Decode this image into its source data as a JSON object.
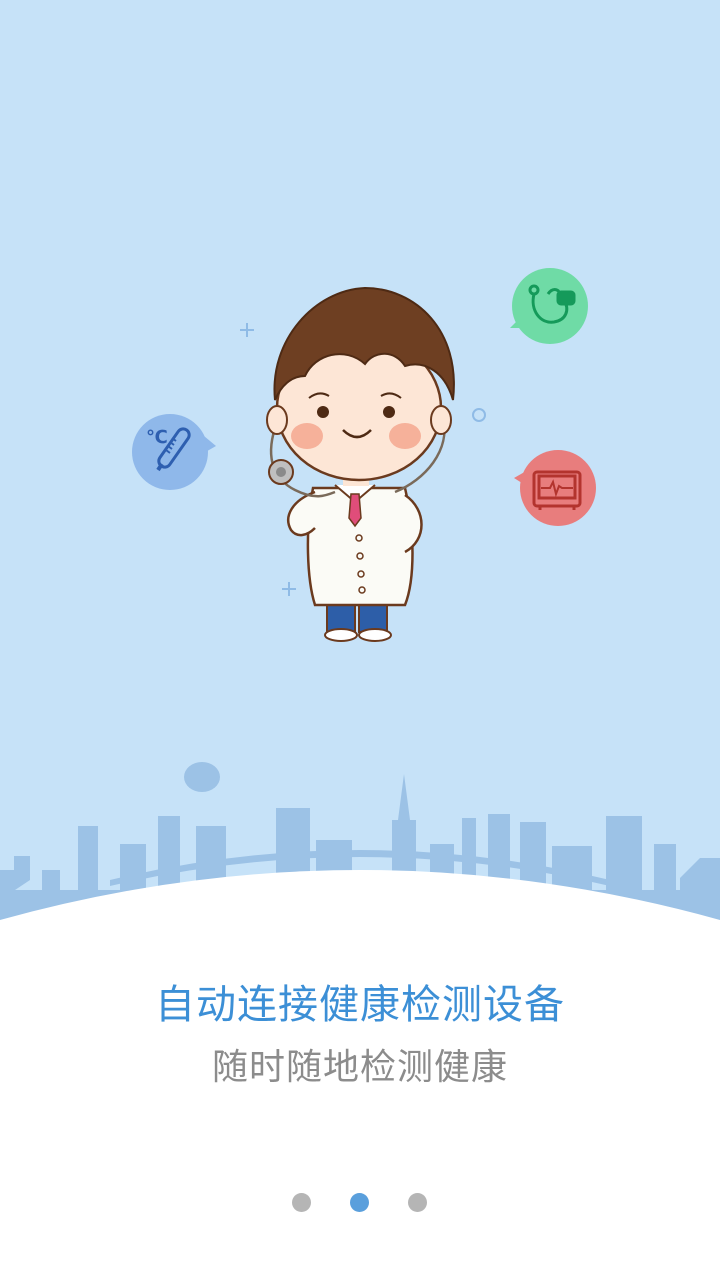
{
  "onboarding": {
    "title": "自动连接健康检测设备",
    "subtitle": "随时随地检测健康",
    "page_indicator": {
      "total": 3,
      "current": 2
    }
  },
  "icons": {
    "thermometer": "thermometer-icon",
    "stethoscope": "stethoscope-icon",
    "monitor": "heart-monitor-icon",
    "thermometer_unit": "℃"
  },
  "colors": {
    "background": "#c6e2f8",
    "title": "#3c8fd6",
    "subtitle": "#8c8c8c",
    "dot_active": "#5a9fdc",
    "dot_inactive": "#b5b5b5",
    "bubble_blue": "#8fb8ea",
    "bubble_green": "#6fdba6",
    "bubble_red": "#e87d7d"
  }
}
